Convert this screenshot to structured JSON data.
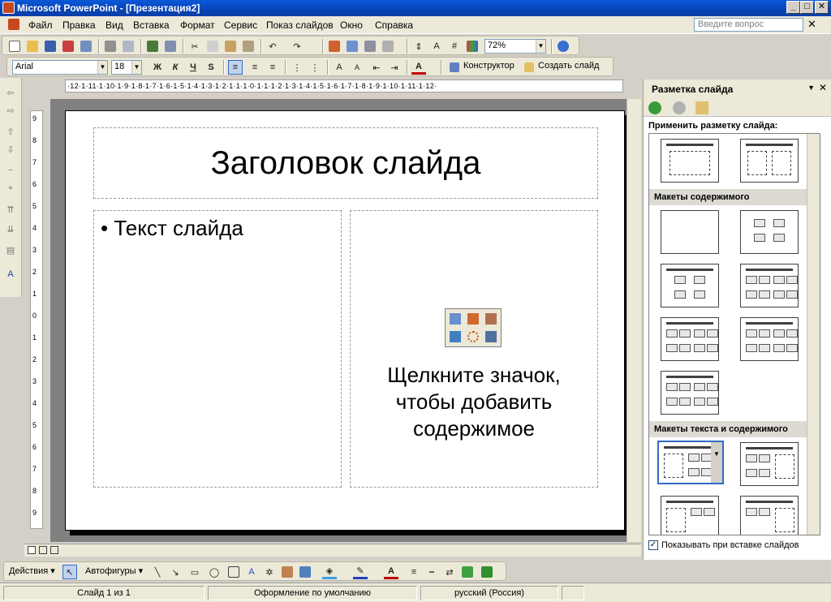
{
  "window": {
    "title": "Microsoft PowerPoint - [Презентация2]",
    "min": "_",
    "max": "□",
    "close": "✕"
  },
  "menu": [
    "Файл",
    "Правка",
    "Вид",
    "Вставка",
    "Формат",
    "Сервис",
    "Показ слайдов",
    "Окно",
    "Справка"
  ],
  "help_placeholder": "Введите вопрос",
  "menu_close": "✕",
  "standard_toolbar": {
    "zoom": "72%"
  },
  "format_toolbar": {
    "font": "Arial",
    "size": "18",
    "bold": "Ж",
    "italic": "К",
    "underline": "Ч",
    "shadow": "S",
    "designer": "Конструктор",
    "new_slide": "Создать слайд"
  },
  "ruler": {
    "horizontal": "·12·1·11·1·10·1·9·1·8·1·7·1·6·1·5·1·4·1·3·1·2·1·1·1·0·1·1·1·2·1·3·1·4·1·5·1·6·1·7·1·8·1·9·1·10·1·11·1·12·",
    "vertical": [
      "9",
      "8",
      "7",
      "6",
      "5",
      "4",
      "3",
      "2",
      "1",
      "0",
      "1",
      "2",
      "3",
      "4",
      "5",
      "6",
      "7",
      "8",
      "9"
    ]
  },
  "slide": {
    "title": "Заголовок слайда",
    "bullet": "•  Текст слайда",
    "content_prompt_1": "Щелкните значок,",
    "content_prompt_2": "чтобы добавить",
    "content_prompt_3": "содержимое"
  },
  "taskpane": {
    "title": "Разметка слайда",
    "apply_label": "Применить разметку слайда:",
    "section_content": "Макеты содержимого",
    "section_text_content": "Макеты текста и содержимого",
    "show_on_insert": "Показывать при вставке слайдов"
  },
  "drawing_toolbar": {
    "actions": "Действия ▾",
    "autoshapes": "Автофигуры ▾"
  },
  "status": {
    "slide": "Слайд 1 из 1",
    "design": "Оформление по умолчанию",
    "language": "русский (Россия)"
  },
  "colors": {
    "title_bar": "#0a58d8",
    "chrome": "#ece9d8",
    "work_area": "#808080",
    "selection": "#316ac5"
  }
}
